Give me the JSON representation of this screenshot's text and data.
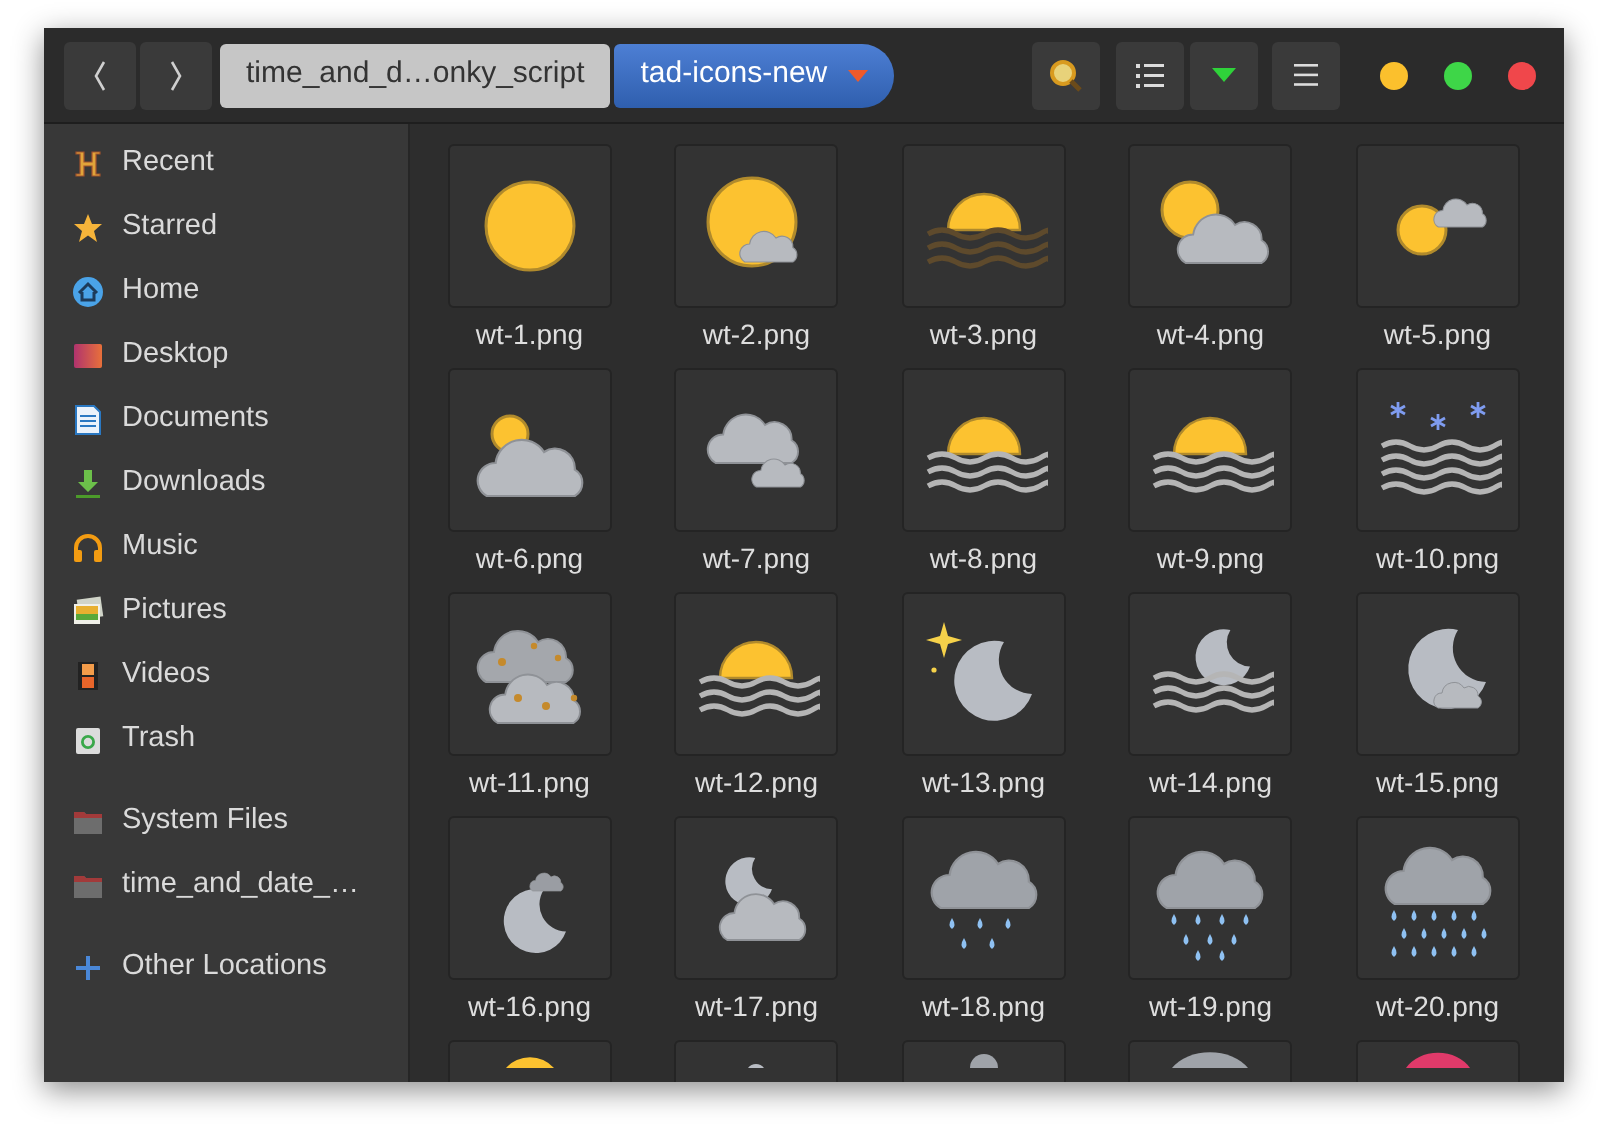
{
  "header": {
    "nav": [
      {
        "kind": "back"
      },
      {
        "kind": "forward"
      }
    ],
    "path": [
      {
        "label": "time_and_d…onky_script",
        "selected": false
      },
      {
        "label": "tad-icons-new",
        "selected": true
      }
    ],
    "tools": [
      {
        "kind": "search"
      },
      {
        "kind": "list"
      },
      {
        "kind": "dropdown"
      },
      {
        "kind": "menu"
      }
    ],
    "window_controls": [
      {
        "color": "#fbc02d"
      },
      {
        "color": "#3ed648"
      },
      {
        "color": "#f0474b"
      }
    ]
  },
  "sidebar": {
    "sections": [
      [
        {
          "label": "Recent",
          "kind": "recent",
          "selected": false
        },
        {
          "label": "Starred",
          "kind": "starred",
          "selected": false
        },
        {
          "label": "Home",
          "kind": "home",
          "selected": false
        },
        {
          "label": "Desktop",
          "kind": "desktop",
          "selected": false
        },
        {
          "label": "Documents",
          "kind": "documents",
          "selected": false
        },
        {
          "label": "Downloads",
          "kind": "downloads",
          "selected": false
        },
        {
          "label": "Music",
          "kind": "music",
          "selected": false
        },
        {
          "label": "Pictures",
          "kind": "pictures",
          "selected": false
        },
        {
          "label": "Videos",
          "kind": "videos",
          "selected": false
        },
        {
          "label": "Trash",
          "kind": "trash",
          "selected": false
        }
      ],
      [
        {
          "label": "System Files",
          "kind": "drive",
          "selected": false
        },
        {
          "label": "time_and_date_…",
          "kind": "drive",
          "selected": false
        }
      ],
      [
        {
          "label": "Other Locations",
          "kind": "other",
          "selected": false
        }
      ]
    ]
  },
  "files": [
    {
      "name": "wt-1.png",
      "kind": "sun"
    },
    {
      "name": "wt-2.png",
      "kind": "sun-cloud"
    },
    {
      "name": "wt-3.png",
      "kind": "sunset-brown"
    },
    {
      "name": "wt-4.png",
      "kind": "sun-cloud-big"
    },
    {
      "name": "wt-5.png",
      "kind": "sun-cloud-small"
    },
    {
      "name": "wt-6.png",
      "kind": "cloud-sun"
    },
    {
      "name": "wt-7.png",
      "kind": "clouds"
    },
    {
      "name": "wt-8.png",
      "kind": "sunset"
    },
    {
      "name": "wt-9.png",
      "kind": "sunset"
    },
    {
      "name": "wt-10.png",
      "kind": "snow-waves"
    },
    {
      "name": "wt-11.png",
      "kind": "hail-clouds"
    },
    {
      "name": "wt-12.png",
      "kind": "sunset"
    },
    {
      "name": "wt-13.png",
      "kind": "moon-star"
    },
    {
      "name": "wt-14.png",
      "kind": "moon-waves"
    },
    {
      "name": "wt-15.png",
      "kind": "moon-cloud"
    },
    {
      "name": "wt-16.png",
      "kind": "moon-low"
    },
    {
      "name": "wt-17.png",
      "kind": "moon-cloud-dark"
    },
    {
      "name": "wt-18.png",
      "kind": "rain-light"
    },
    {
      "name": "wt-19.png",
      "kind": "rain"
    },
    {
      "name": "wt-20.png",
      "kind": "rain-heavy"
    }
  ],
  "clipped_files": [
    {
      "kind": "sun"
    },
    {
      "kind": "moon-low"
    },
    {
      "kind": "rain-light"
    },
    {
      "kind": "sun-cloud-small"
    },
    {
      "kind": "red"
    }
  ]
}
